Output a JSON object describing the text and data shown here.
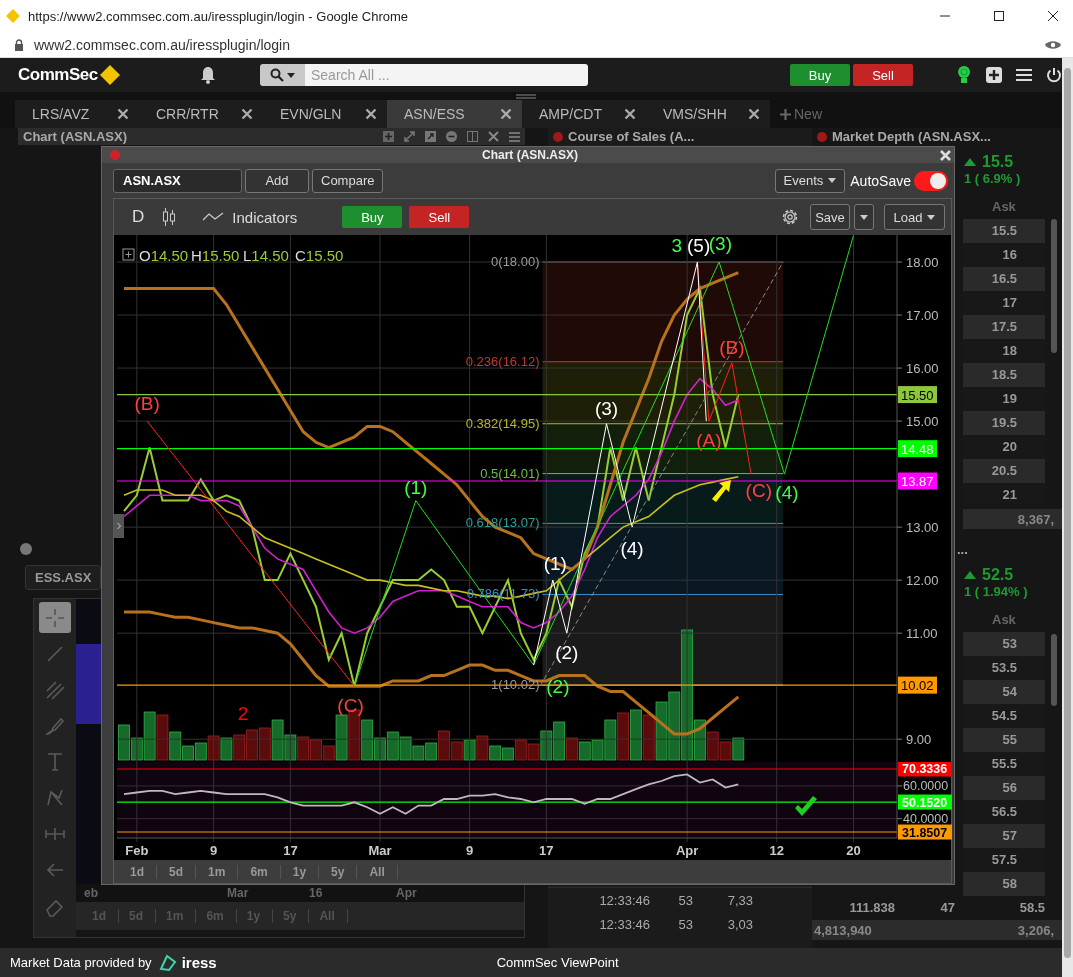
{
  "browser": {
    "title": "https://www2.commsec.com.au/iressplugin/login - Google Chrome",
    "url": "www2.commsec.com.au/iressplugin/login"
  },
  "header": {
    "logo": "CommSec",
    "search": {
      "placeholder": "Search All ..."
    },
    "buttons": [
      {
        "label": "Buy",
        "kind": "buy"
      },
      {
        "label": "Sell",
        "kind": "sell"
      }
    ]
  },
  "tabs": [
    {
      "label": "LRS/AVZ",
      "selected": false
    },
    {
      "label": "CRR/RTR",
      "selected": false
    },
    {
      "label": "EVN/GLN",
      "selected": false
    },
    {
      "label": "ASN/ESS",
      "selected": true
    },
    {
      "label": "AMP/CDT",
      "selected": false
    },
    {
      "label": "VMS/SHH",
      "selected": false
    }
  ],
  "new_tab": "New",
  "chart_panel": {
    "title": "Chart (ASN.ASX)"
  },
  "ess_panel": {
    "symbol": "ESS.ASX",
    "tools": [
      {
        "kind": "crosshair",
        "selected": true
      },
      {
        "kind": "line",
        "selected": false
      },
      {
        "kind": "fork",
        "selected": false
      },
      {
        "kind": "brush",
        "selected": false
      },
      {
        "kind": "text",
        "selected": false
      },
      {
        "kind": "nodes",
        "selected": false
      },
      {
        "kind": "ruler",
        "selected": false
      },
      {
        "kind": "back",
        "selected": false
      },
      {
        "kind": "eraser",
        "selected": false
      }
    ],
    "x_labels": [
      "eb",
      "Mar",
      "16",
      "Apr"
    ],
    "ranges": [
      "1d",
      "5d",
      "1m",
      "6m",
      "1y",
      "5y",
      "All"
    ]
  },
  "course_of_sales": {
    "title": "Course of Sales (A...",
    "rows": [
      [
        "12:33:46",
        "53",
        "7,33"
      ],
      [
        "12:33:46",
        "53",
        "3,03"
      ]
    ]
  },
  "market_depth": [
    {
      "title": "Market Depth (ASN.ASX...",
      "price": "15.5",
      "change": "1 ( 6.9% )",
      "ask_header": "Ask",
      "rows": [
        [
          "15.5"
        ],
        [
          "16"
        ],
        [
          "16.5"
        ],
        [
          "17"
        ],
        [
          "17.5"
        ],
        [
          "18"
        ],
        [
          "18.5"
        ],
        [
          "19"
        ],
        [
          "19.5"
        ],
        [
          "20"
        ],
        [
          "20.5"
        ],
        [
          "21"
        ]
      ],
      "totals": [
        "8,367,"
      ]
    },
    {
      "title": "...",
      "price": "52.5",
      "change": "1 ( 1.94% )",
      "ask_header": "Ask",
      "rows": [
        [
          "53"
        ],
        [
          "53.5"
        ],
        [
          "54"
        ],
        [
          "54.5"
        ],
        [
          "55"
        ],
        [
          "55.5"
        ],
        [
          "56"
        ],
        [
          "56.5"
        ],
        [
          "57"
        ],
        [
          "57.5"
        ],
        [
          "58"
        ],
        [
          "111.838",
          "47",
          "58.5"
        ]
      ],
      "totals": [
        "4,813,940",
        "3,206,"
      ]
    }
  ],
  "chart_window": {
    "title": "Chart (ASN.ASX)",
    "symbol": "ASN.ASX",
    "buttons": [
      "Add",
      "Compare"
    ],
    "events": "Events",
    "autosave": {
      "label": "AutoSave",
      "on": true
    },
    "interval": "D",
    "indicators": "Indicators",
    "trade_buttons": [
      {
        "label": "Buy",
        "kind": "buy"
      },
      {
        "label": "Sell",
        "kind": "sell"
      }
    ],
    "save": "Save",
    "load": "Load",
    "ohlc": [
      {
        "key": "O",
        "value": "14.50"
      },
      {
        "key": "H",
        "value": "15.50"
      },
      {
        "key": "L",
        "value": "14.50"
      },
      {
        "key": "C",
        "value": "15.50"
      }
    ],
    "price_chart": {
      "chart_data": {
        "type": "line",
        "grid": true,
        "ylim": [
          8.57,
          18.51
        ],
        "yticks": [
          {
            "value": 18,
            "label": "18.00"
          },
          {
            "value": 17,
            "label": "17.00"
          },
          {
            "value": 16,
            "label": "16.00"
          },
          {
            "value": 15,
            "label": "15.00"
          },
          {
            "value": 13,
            "label": "13.00"
          },
          {
            "value": 12,
            "label": "12.00"
          },
          {
            "value": 11,
            "label": "11.00"
          },
          {
            "value": 9,
            "label": "9.00"
          }
        ],
        "series": [
          {
            "color": "#9acd32",
            "values": [
              13.3,
              13.6,
              14.5,
              13.5,
              13.5,
              13.5,
              13.9,
              13.5,
              13.6,
              13.5,
              13.0,
              12.0,
              12.0,
              12.5,
              12.0,
              11.5,
              10.5,
              11.0,
              10.0,
              11.0,
              11.5,
              12.0,
              12.0,
              12.0,
              12.2,
              12.0,
              11.5,
              11.5,
              11.0,
              11.5,
              12.0,
              11.0,
              10.5,
              11.0,
              12.0,
              11.5,
              12.5,
              13.0,
              14.5,
              13.5,
              14.5,
              13.5,
              14.5,
              15.5,
              17.0,
              17.5,
              15.5,
              14.5,
              15.5,
              null,
              null,
              null,
              null,
              null,
              null,
              null,
              null,
              null,
              null,
              null,
              null
            ]
          },
          {
            "color": "#d020d0",
            "values": [
              13.2,
              13.4,
              13.6,
              13.6,
              13.6,
              13.6,
              13.5,
              13.5,
              13.5,
              13.4,
              13.0,
              12.6,
              12.4,
              12.3,
              12.2,
              11.8,
              11.4,
              11.1,
              11.0,
              11.1,
              11.3,
              11.6,
              11.7,
              11.8,
              11.8,
              11.8,
              11.7,
              11.6,
              11.5,
              11.5,
              11.5,
              11.2,
              11.1,
              11.2,
              11.4,
              11.7,
              12.2,
              12.8,
              13.2,
              13.4,
              13.6,
              13.9,
              14.4,
              15.0,
              15.5,
              15.8,
              15.6,
              15.3,
              15.4,
              null,
              null,
              null,
              null,
              null,
              null,
              null,
              null,
              null,
              null,
              null,
              null
            ]
          },
          {
            "color": "#c8c020",
            "values": [
              13.6,
              13.7,
              13.7,
              13.7,
              13.6,
              13.6,
              13.6,
              13.5,
              13.3,
              13.2,
              13.0,
              12.8,
              12.7,
              12.6,
              12.5,
              12.4,
              12.3,
              12.2,
              12.1,
              12.0,
              12.0,
              11.95,
              11.9,
              11.9,
              11.85,
              11.8,
              11.8,
              11.75,
              11.7,
              11.7,
              11.65,
              11.7,
              11.75,
              11.8,
              12.0,
              12.2,
              12.4,
              12.6,
              12.8,
              13.0,
              13.1,
              13.2,
              13.4,
              13.6,
              13.7,
              13.8,
              13.85,
              13.9,
              13.95,
              null,
              null,
              null,
              null,
              null,
              null,
              null,
              null,
              null,
              null,
              null,
              null
            ]
          },
          {
            "color": "#b8711c",
            "values": [
              17.5,
              17.5,
              17.5,
              17.5,
              17.5,
              17.5,
              17.5,
              17.5,
              17.2,
              16.8,
              16.4,
              16.0,
              15.6,
              15.2,
              14.8,
              14.6,
              14.5,
              14.6,
              14.7,
              14.9,
              14.9,
              14.8,
              14.6,
              14.4,
              14.2,
              14.0,
              13.8,
              13.5,
              13.2,
              13.0,
              12.9,
              12.8,
              12.5,
              12.4,
              12.3,
              12.2,
              12.4,
              13.0,
              13.8,
              14.6,
              15.2,
              15.8,
              16.5,
              17.0,
              17.3,
              17.5,
              17.6,
              17.7,
              17.8,
              null,
              null,
              null,
              null,
              null,
              null,
              null,
              null,
              null,
              null,
              null,
              null
            ]
          },
          {
            "color": "#b8711c",
            "values": [
              11.4,
              11.4,
              11.4,
              11.35,
              11.3,
              11.3,
              11.25,
              11.2,
              11.15,
              11.1,
              11.1,
              11.05,
              11.0,
              10.8,
              10.5,
              10.2,
              10.0,
              10.0,
              10.0,
              10.0,
              10.0,
              10.1,
              10.1,
              10.1,
              10.2,
              10.2,
              10.3,
              10.4,
              10.4,
              10.3,
              10.3,
              10.2,
              10.1,
              10.1,
              10.2,
              10.2,
              10.2,
              10.0,
              9.9,
              9.9,
              9.7,
              9.5,
              9.3,
              9.1,
              9.1,
              9.2,
              9.4,
              9.6,
              9.8,
              null,
              null,
              null,
              null,
              null,
              null,
              null,
              null,
              null,
              null,
              null,
              null
            ]
          }
        ],
        "ref_lines": [
          {
            "axis": "y",
            "value": 15.5,
            "label": "15.50",
            "color": "#8dc63f"
          },
          {
            "axis": "y",
            "value": 14.48,
            "label": "14.48",
            "color": "#00ff00"
          },
          {
            "axis": "y",
            "value": 13.87,
            "label": "13.87",
            "color": "#ff00ff"
          },
          {
            "axis": "y",
            "value": 10.02,
            "label": "10.02",
            "color": "#ff9900"
          }
        ]
      }
    },
    "fibonacci": [
      {
        "label": "0(18.00)",
        "color": "#9a9a9a"
      },
      {
        "label": "0.236(16.12)",
        "color": "#c0392b"
      },
      {
        "label": "0.382(14.95)",
        "color": "#b5b52e"
      },
      {
        "label": "0.5(14.01)",
        "color": "#6abf40"
      },
      {
        "label": "0.618(13.07)",
        "color": "#2aa198"
      },
      {
        "label": "0.786(11.73)",
        "color": "#3a8fd0"
      },
      {
        "label": "1(10.02)",
        "color": "#9a9a9a"
      }
    ],
    "wave_labels": [
      {
        "label": "3",
        "color": "#40ff40"
      },
      {
        "label": "(5)",
        "color": "#ffffff"
      },
      {
        "label": "(3)",
        "color": "#40ff40"
      },
      {
        "label": "(B)",
        "color": "#ff4040"
      },
      {
        "label": "(B)",
        "color": "#ff4040"
      },
      {
        "label": "(3)",
        "color": "#ffffff"
      },
      {
        "label": "(A)",
        "color": "#ff4040"
      },
      {
        "label": "(1)",
        "color": "#40ff40"
      },
      {
        "label": "(C)",
        "color": "#ff4040"
      },
      {
        "label": "(4)",
        "color": "#40ff40"
      },
      {
        "label": "(4)",
        "color": "#ffffff"
      },
      {
        "label": "(1)",
        "color": "#ffffff"
      },
      {
        "label": "(2)",
        "color": "#ffffff"
      },
      {
        "label": "(2)",
        "color": "#40ff40"
      },
      {
        "label": "(C)",
        "color": "#ff4040"
      },
      {
        "label": "2",
        "color": "#ff0000"
      }
    ],
    "rsi_chart": {
      "chart_data": {
        "type": "line",
        "grid": true,
        "ylim": [
          28.2,
          74.6
        ],
        "categories": [
          null,
          "Feb",
          null,
          null,
          null,
          null,
          null,
          "9",
          null,
          null,
          null,
          null,
          null,
          "17",
          null,
          null,
          null,
          null,
          null,
          null,
          "Mar",
          null,
          null,
          null,
          null,
          null,
          null,
          "9",
          null,
          null,
          null,
          null,
          null,
          "17",
          null,
          null,
          null,
          null,
          null,
          null,
          null,
          null,
          null,
          null,
          "Apr",
          null,
          null,
          null,
          null,
          null,
          null,
          "12",
          null,
          null,
          null,
          null,
          null,
          "20",
          null,
          null,
          null
        ],
        "yticks": [
          {
            "value": 60,
            "label": "60.0000"
          },
          {
            "value": 40,
            "label": "40.0000"
          }
        ],
        "series": [
          {
            "color": "#c0b8c0",
            "values": [
              55,
              56,
              57,
              57,
              55,
              56,
              57,
              56,
              55,
              55,
              55,
              55,
              53,
              50,
              48,
              48,
              48,
              48,
              50,
              47,
              43,
              47,
              43,
              48,
              48,
              52,
              52,
              54,
              54,
              55,
              53,
              52,
              50,
              52,
              52,
              52,
              49,
              52,
              52,
              55,
              58,
              61,
              63,
              66,
              67,
              62,
              64,
              59,
              61,
              null,
              null,
              null,
              null,
              null,
              null,
              null,
              null,
              null,
              null,
              null,
              null
            ]
          }
        ],
        "ref_lines": [
          {
            "axis": "y",
            "value": 70.3336,
            "label": "70.3336",
            "color": "#ff0000"
          },
          {
            "axis": "y",
            "value": 50.152,
            "label": "50.1520",
            "color": "#00ff00"
          },
          {
            "axis": "y",
            "value": 31.8507,
            "label": "31.8507",
            "color": "#ff9900"
          }
        ]
      }
    },
    "ranges": [
      "1d",
      "5d",
      "1m",
      "6m",
      "1y",
      "5y",
      "All"
    ]
  },
  "footer": {
    "provider": "Market Data provided by",
    "provider_logo": "iress",
    "app_name": "CommSec ViewPoint"
  }
}
